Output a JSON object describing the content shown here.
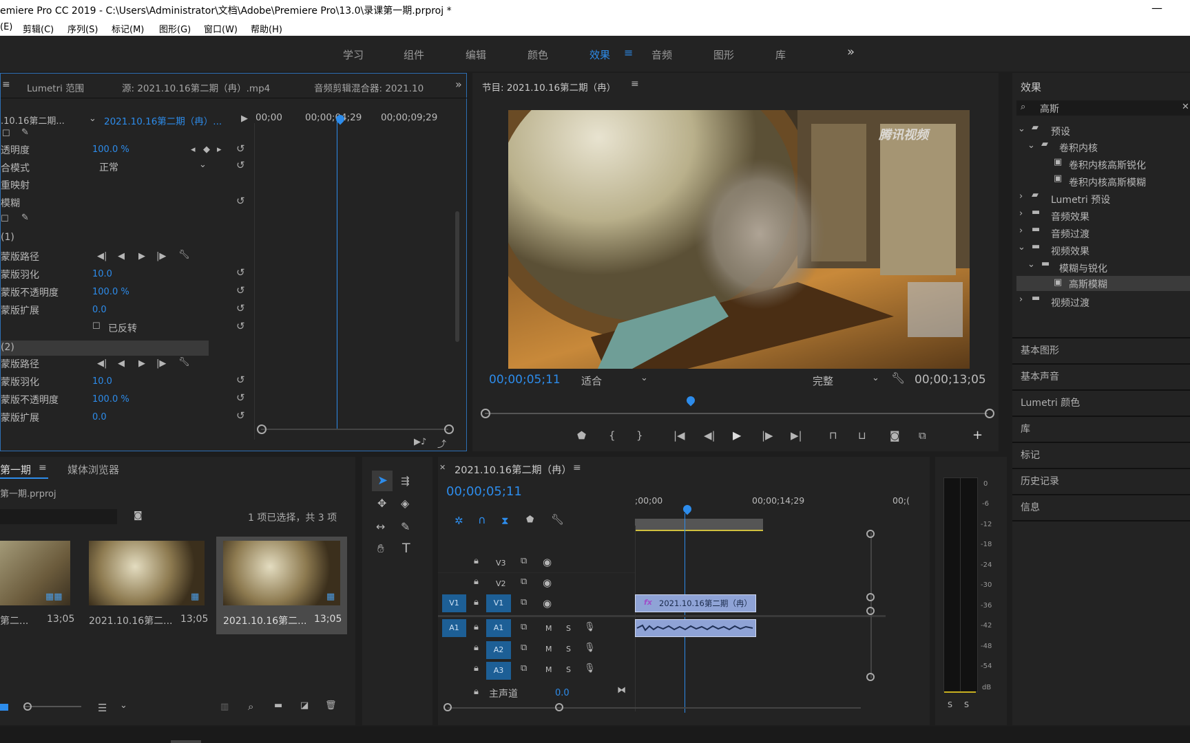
{
  "titlebar": {
    "title": "emiere Pro CC 2019 - C:\\Users\\Administrator\\文档\\Adobe\\Premiere Pro\\13.0\\录课第一期.prproj *",
    "minimize": "—"
  },
  "menu": [
    "(E)",
    "剪辑(C)",
    "序列(S)",
    "标记(M)",
    "图形(G)",
    "窗口(W)",
    "帮助(H)"
  ],
  "workspaces": {
    "items": [
      "学习",
      "组件",
      "编辑",
      "颜色",
      "效果",
      "音频",
      "图形",
      "库"
    ],
    "active": "效果",
    "more": "»"
  },
  "effect_controls": {
    "tabs": [
      "Lumetri 范围",
      "源: 2021.10.16第二期（冉）.mp4",
      "音频剪辑混合器: 2021.10"
    ],
    "clip_left": ".10.16第二期...",
    "clip_right": "2021.10.16第二期（冉）...",
    "ruler": [
      "00;00",
      "00;00;04;29",
      "00;00;09;29"
    ],
    "rows": [
      {
        "label": "透明度",
        "value": "100.0 %"
      },
      {
        "label": "合模式",
        "value": "正常"
      },
      {
        "label": "重映射",
        "value": ""
      },
      {
        "label": "模糊",
        "value": ""
      },
      {
        "label": "(1)",
        "value": ""
      },
      {
        "label": "蒙版路径",
        "value": ""
      },
      {
        "label": "蒙版羽化",
        "value": "10.0"
      },
      {
        "label": "蒙版不透明度",
        "value": "100.0 %"
      },
      {
        "label": "蒙版扩展",
        "value": "0.0"
      },
      {
        "label": "已反转",
        "value": ""
      },
      {
        "label": "(2)",
        "value": ""
      },
      {
        "label": "蒙版路径",
        "value": ""
      },
      {
        "label": "蒙版羽化",
        "value": "10.0"
      },
      {
        "label": "蒙版不透明度",
        "value": "100.0 %"
      },
      {
        "label": "蒙版扩展",
        "value": "0.0"
      }
    ]
  },
  "program": {
    "title": "节目: 2021.10.16第二期（冉）",
    "watermark": "腾讯视频",
    "timecode": "00;00;05;11",
    "fit": "适合",
    "quality": "完整",
    "duration": "00;00;13;05"
  },
  "effects_panel": {
    "title": "效果",
    "search": "高斯",
    "tree": [
      {
        "label": "预设",
        "depth": 0,
        "open": true,
        "kind": "preset-folder"
      },
      {
        "label": "卷积内核",
        "depth": 1,
        "open": true,
        "kind": "preset-folder"
      },
      {
        "label": "卷积内核高斯锐化",
        "depth": 2,
        "kind": "preset"
      },
      {
        "label": "卷积内核高斯模糊",
        "depth": 2,
        "kind": "preset"
      },
      {
        "label": "Lumetri 预设",
        "depth": 0,
        "open": false,
        "kind": "preset-folder"
      },
      {
        "label": "音频效果",
        "depth": 0,
        "open": false,
        "kind": "folder"
      },
      {
        "label": "音频过渡",
        "depth": 0,
        "open": false,
        "kind": "folder"
      },
      {
        "label": "视频效果",
        "depth": 0,
        "open": true,
        "kind": "folder"
      },
      {
        "label": "模糊与锐化",
        "depth": 1,
        "open": true,
        "kind": "folder"
      },
      {
        "label": "高斯模糊",
        "depth": 2,
        "kind": "effect",
        "selected": true
      },
      {
        "label": "视频过渡",
        "depth": 0,
        "open": false,
        "kind": "folder"
      }
    ],
    "sections": [
      "基本图形",
      "基本声音",
      "Lumetri 颜色",
      "库",
      "标记",
      "历史记录",
      "信息"
    ]
  },
  "project": {
    "tabs": [
      "第一期",
      "媒体浏览器"
    ],
    "file": "第一期.prproj",
    "status": "1 项已选择，共 3 项",
    "items": [
      {
        "name": "第二...",
        "dur": "13;05"
      },
      {
        "name": "2021.10.16第二...",
        "dur": "13;05"
      },
      {
        "name": "2021.10.16第二...",
        "dur": "13;05"
      }
    ]
  },
  "timeline": {
    "title": "2021.10.16第二期（冉）",
    "timecode": "00;00;05;11",
    "ruler": [
      ";00;00",
      "00;00;14;29",
      "00;("
    ],
    "clip_v": "2021.10.16第二期（冉）",
    "tracks": [
      {
        "name": "V3",
        "src": ""
      },
      {
        "name": "V2",
        "src": ""
      },
      {
        "name": "V1",
        "src": "V1"
      },
      {
        "name": "A1",
        "src": "A1",
        "M": "M",
        "S": "S"
      },
      {
        "name": "A2",
        "src": "",
        "M": "M",
        "S": "S"
      },
      {
        "name": "A3",
        "src": "",
        "M": "M",
        "S": "S"
      }
    ],
    "master_label": "主声道",
    "master_value": "0.0"
  },
  "meter": {
    "ticks": [
      "0",
      "-6",
      "-12",
      "-18",
      "-24",
      "-30",
      "-36",
      "-42",
      "-48",
      "-54",
      "dB"
    ],
    "solo": [
      "S",
      "S"
    ]
  }
}
